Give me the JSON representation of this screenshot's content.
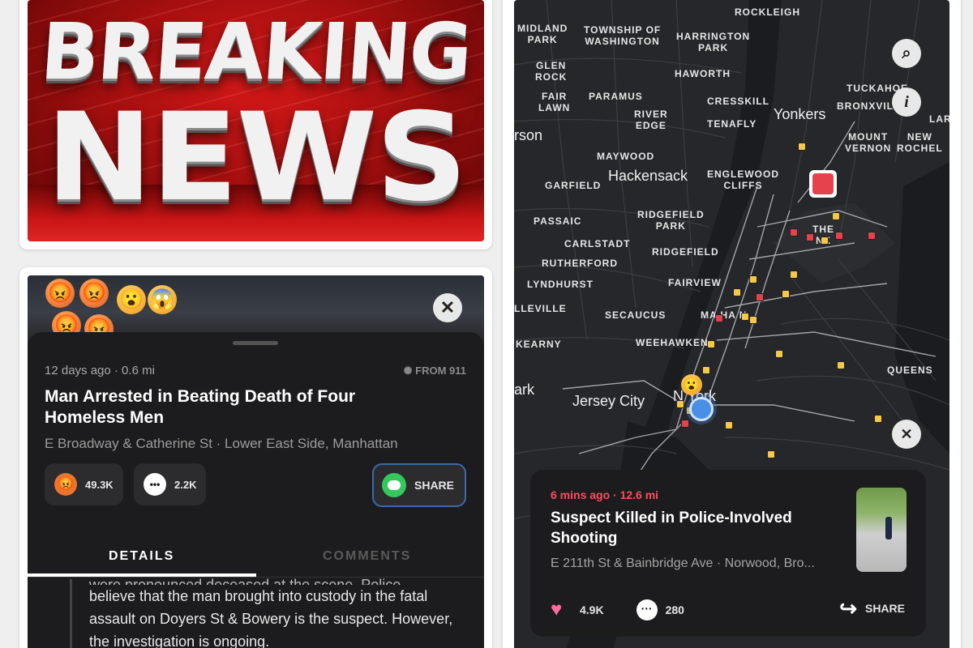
{
  "news_banner": {
    "line1": "BREAKING",
    "line2": "NEWS"
  },
  "detail": {
    "meta": "12 days ago · 0.6 mi",
    "source": "FROM 911",
    "title": "Man Arrested in Beating Death of Four Homeless Men",
    "address": "E Broadway & Catherine St · Lower East Side, Manhattan",
    "reactions": "49.3K",
    "comments": "2.2K",
    "share_label": "SHARE",
    "tabs": [
      "DETAILS",
      "COMMENTS"
    ],
    "body_partial": "were pronounced deceased at the scene. Police",
    "body": "believe that the man brought into custody in the fatal assault on Doyers St & Bowery is the suspect. However, the investigation is ongoing.",
    "close_symbol": "✕"
  },
  "map": {
    "places": [
      {
        "name": "ROCKLEIGH",
        "lines": [
          "ROCKLEIGH"
        ]
      },
      {
        "name": "MIDLAND PARK",
        "lines": [
          "MIDLAND",
          "PARK"
        ]
      },
      {
        "name": "TOWNSHIP OF WASHINGTON",
        "lines": [
          "TOWNSHIP OF",
          "WASHINGTON"
        ]
      },
      {
        "name": "HARRINGTON PARK",
        "lines": [
          "HARRINGTON",
          "PARK"
        ]
      },
      {
        "name": "GLEN ROCK",
        "lines": [
          "GLEN",
          "ROCK"
        ]
      },
      {
        "name": "HAWORTH",
        "lines": [
          "HAWORTH"
        ]
      },
      {
        "name": "TUCKAHOE",
        "lines": [
          "TUCKAHOE"
        ]
      },
      {
        "name": "BRONXVILLE",
        "lines": [
          "BRONXVILLE"
        ]
      },
      {
        "name": "FAIR LAWN",
        "lines": [
          "FAIR",
          "LAWN"
        ]
      },
      {
        "name": "PARAMUS",
        "lines": [
          "PARAMUS"
        ]
      },
      {
        "name": "CRESSKILL",
        "lines": [
          "CRESSKILL"
        ]
      },
      {
        "name": "RIVER EDGE",
        "lines": [
          "RIVER",
          "EDGE"
        ]
      },
      {
        "name": "TENAFLY",
        "lines": [
          "TENAFLY"
        ]
      },
      {
        "name": "Yonkers",
        "lines": [
          "Yonkers"
        ]
      },
      {
        "name": "MOUNT VERNON",
        "lines": [
          "MOUNT",
          "VERNON"
        ]
      },
      {
        "name": "NEW ROCHELLE",
        "lines": [
          "NEW",
          "ROCHEL"
        ]
      },
      {
        "name": "rson",
        "lines": [
          "rson"
        ]
      },
      {
        "name": "MAYWOOD",
        "lines": [
          "MAYWOOD"
        ]
      },
      {
        "name": "Hackensack",
        "lines": [
          "Hackensack"
        ]
      },
      {
        "name": "ENGLEWOOD CLIFFS",
        "lines": [
          "ENGLEWOOD",
          "CLIFFS"
        ]
      },
      {
        "name": "GARFIELD",
        "lines": [
          "GARFIELD"
        ]
      },
      {
        "name": "RIDGEFIELD PARK",
        "lines": [
          "RIDGEFIELD",
          "PARK"
        ]
      },
      {
        "name": "PASSAIC",
        "lines": [
          "PASSAIC"
        ]
      },
      {
        "name": "CARLSTADT",
        "lines": [
          "CARLSTADT"
        ]
      },
      {
        "name": "RIDGEFIELD",
        "lines": [
          "RIDGEFIELD"
        ]
      },
      {
        "name": "RUTHERFORD",
        "lines": [
          "RUTHERFORD"
        ]
      },
      {
        "name": "LYNDHURST",
        "lines": [
          "LYNDHURST"
        ]
      },
      {
        "name": "FAIRVIEW",
        "lines": [
          "FAIRVIEW"
        ]
      },
      {
        "name": "LLEVILLE",
        "lines": [
          "LLEVILLE"
        ]
      },
      {
        "name": "SECAUCUS",
        "lines": [
          "SECAUCUS"
        ]
      },
      {
        "name": "MANHATTAN",
        "lines": [
          "MA  HA  N"
        ]
      },
      {
        "name": "KEARNY",
        "lines": [
          "KEARNY"
        ]
      },
      {
        "name": "WEEHAWKEN",
        "lines": [
          "WEEHAWKEN"
        ]
      },
      {
        "name": "QUEENS",
        "lines": [
          "QUEENS"
        ]
      },
      {
        "name": "ark",
        "lines": [
          "ark"
        ]
      },
      {
        "name": "Jersey City",
        "lines": [
          "Jersey City"
        ]
      },
      {
        "name": "New York",
        "lines": [
          "N    York"
        ]
      },
      {
        "name": "THE BRONX",
        "lines": [
          "THE",
          "    NX"
        ]
      },
      {
        "name": "LAR",
        "lines": [
          "LAR"
        ]
      }
    ],
    "zoom_symbol": "⌕",
    "info_symbol": "i",
    "close_symbol": "✕",
    "card": {
      "meta": "6 mins ago · 12.6 mi",
      "title": "Suspect Killed in Police-Involved Shooting",
      "address": "E 211th St & Bainbridge Ave · Norwood, Bro...",
      "likes": "4.9K",
      "comments": "280",
      "share_label": "SHARE"
    }
  },
  "colors": {
    "accent_red": "#e5424d",
    "incident_yellow": "#f5c84a",
    "share_green": "#34c759"
  }
}
